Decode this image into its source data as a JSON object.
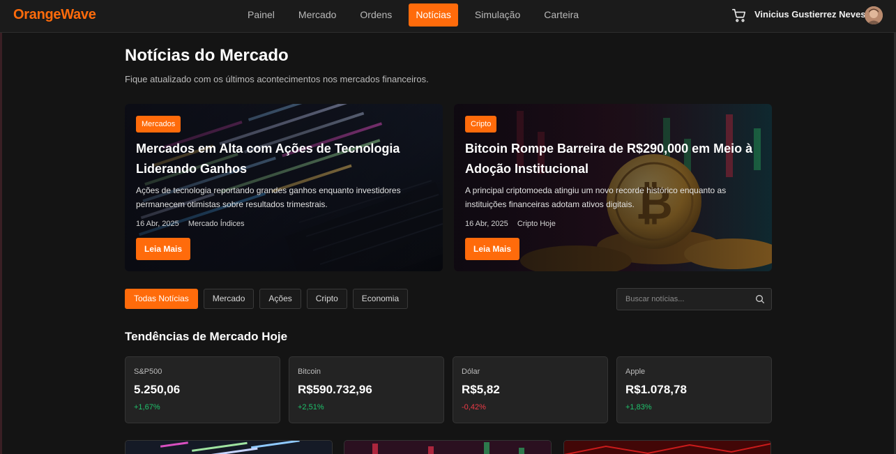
{
  "app": {
    "brand": "OrangeWave"
  },
  "nav": {
    "items": [
      {
        "label": "Painel",
        "active": false
      },
      {
        "label": "Mercado",
        "active": false
      },
      {
        "label": "Ordens",
        "active": false
      },
      {
        "label": "Notícias",
        "active": true
      },
      {
        "label": "Simulação",
        "active": false
      },
      {
        "label": "Carteira",
        "active": false
      }
    ]
  },
  "user": {
    "name": "Vinicius Gustierrez Neves",
    "cart_icon": "cart-icon",
    "avatar_icon": "avatar"
  },
  "page": {
    "title": "Notícias do Mercado",
    "subtitle": "Fique atualizado com os últimos acontecimentos nos mercados financeiros."
  },
  "featured": [
    {
      "badge": "Mercados",
      "title": "Mercados em Alta com Ações de Tecnologia Liderando Ganhos",
      "description": "Ações de tecnologia reportando grandes ganhos enquanto investidores permanecem otimistas sobre resultados trimestrais.",
      "date": "16 Abr, 2025",
      "source": "Mercado Índices",
      "cta": "Leia Mais"
    },
    {
      "badge": "Cripto",
      "title": "Bitcoin Rompe Barreira de R$290,000 em Meio à Adoção Institucional",
      "description": "A principal criptomoeda atingiu um novo recorde histórico enquanto as instituições financeiras adotam ativos digitais.",
      "date": "16 Abr, 2025",
      "source": "Cripto Hoje",
      "cta": "Leia Mais"
    }
  ],
  "filters": {
    "items": [
      "Todas Notícias",
      "Mercado",
      "Ações",
      "Cripto",
      "Economia"
    ],
    "active": "Todas Notícias"
  },
  "search": {
    "placeholder": "Buscar notícias...",
    "value": ""
  },
  "trends": {
    "title": "Tendências de Mercado Hoje",
    "items": [
      {
        "name": "S&P500",
        "value": "5.250,06",
        "change": "+1,67%",
        "direction": "up"
      },
      {
        "name": "Bitcoin",
        "value": "R$590.732,96",
        "change": "+2,51%",
        "direction": "up"
      },
      {
        "name": "Dólar",
        "value": "R$5,82",
        "change": "-0,42%",
        "direction": "down"
      },
      {
        "name": "Apple",
        "value": "R$1.078,78",
        "change": "+1,83%",
        "direction": "up"
      }
    ]
  },
  "colors": {
    "accent": "#ff6b0b",
    "up": "#1fc16b",
    "down": "#ef3b47",
    "background": "#141414"
  }
}
